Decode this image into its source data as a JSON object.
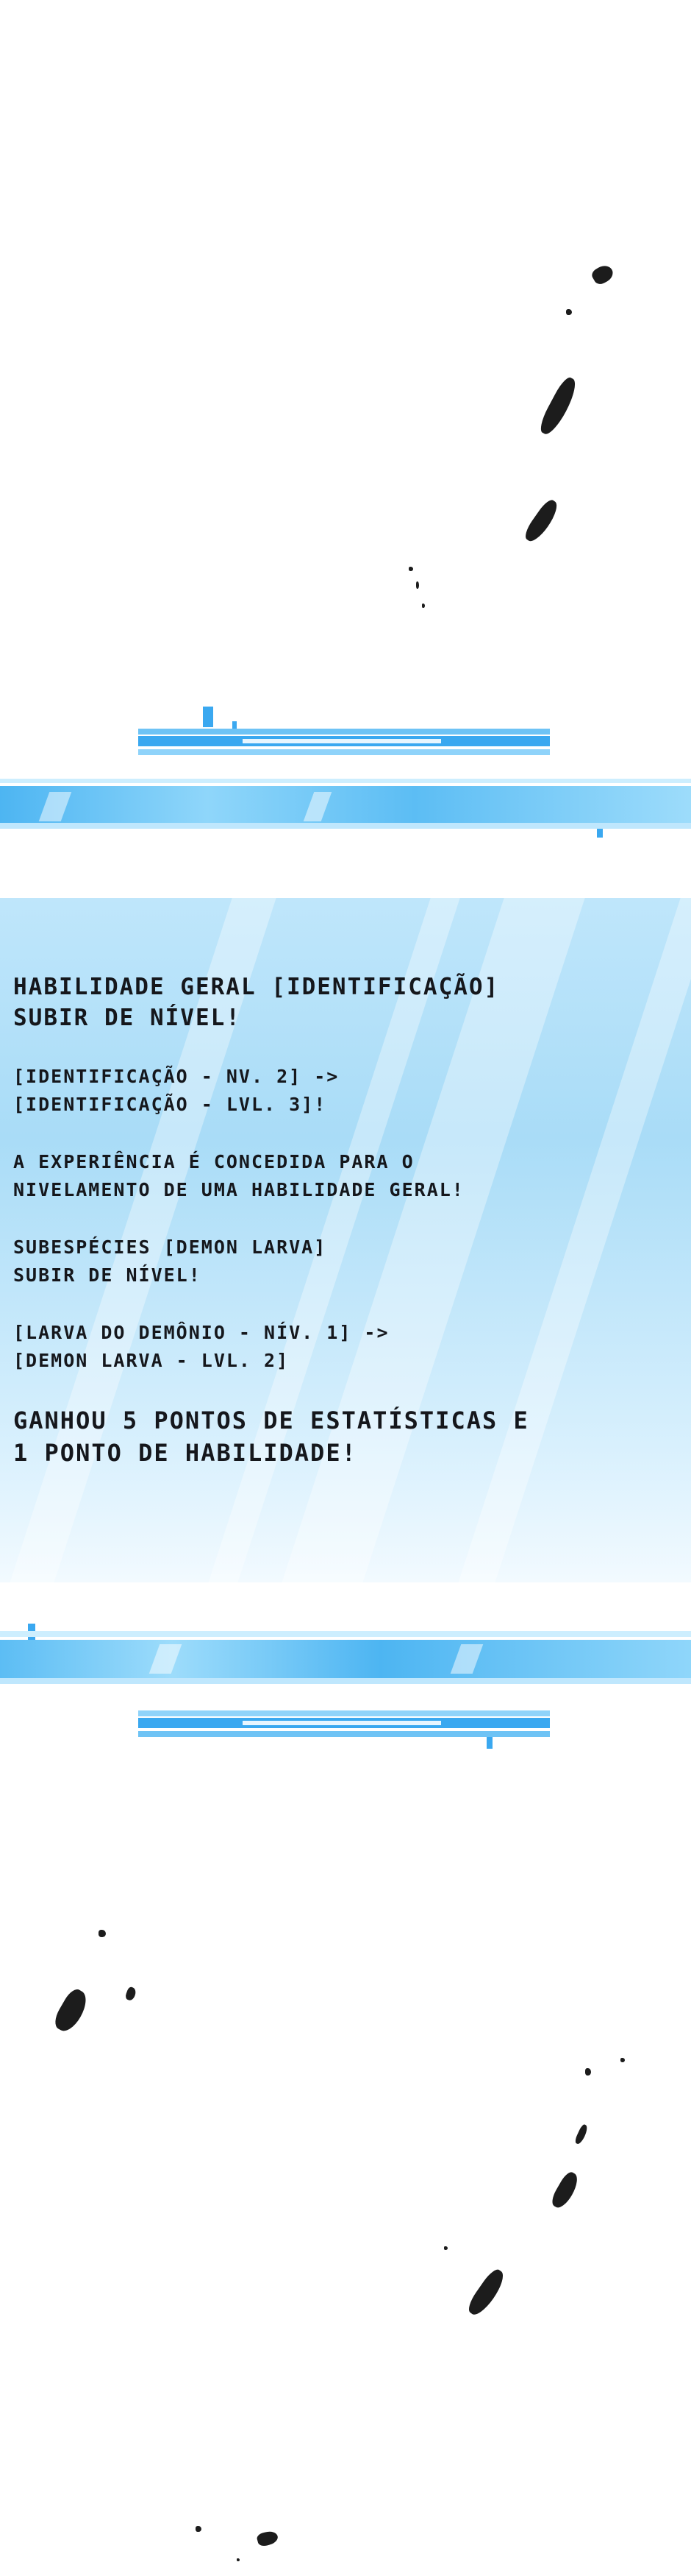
{
  "panel": {
    "blocks": [
      {
        "size": "lg",
        "lines": [
          "Habilidade Geral [Identificação]",
          "subir de nível!"
        ]
      },
      {
        "size": "sm",
        "lines": [
          "[Identificação - Nv. 2] ->",
          "[Identificação - Lvl. 3]!"
        ]
      },
      {
        "size": "sm",
        "lines": [
          "A experiência é concedida para o",
          "nivelamento de uma habilidade geral!"
        ]
      },
      {
        "size": "sm",
        "lines": [
          "Subespécies [Demon Larva]",
          "subir de nível!"
        ]
      },
      {
        "size": "sm",
        "lines": [
          "[Larva do Demônio - Nív. 1] ->",
          "[Demon Larva - Lvl. 2]"
        ]
      },
      {
        "size": "xl",
        "lines": [
          "Ganhou 5 pontos de estatísticas e",
          "1 ponto de habilidade!"
        ]
      }
    ]
  },
  "colors": {
    "accent_blue": "#3aa8f0",
    "light_blue": "#8fd3fa",
    "panel_bg": "#b7e2f9",
    "ink": "#1c1c1c"
  }
}
